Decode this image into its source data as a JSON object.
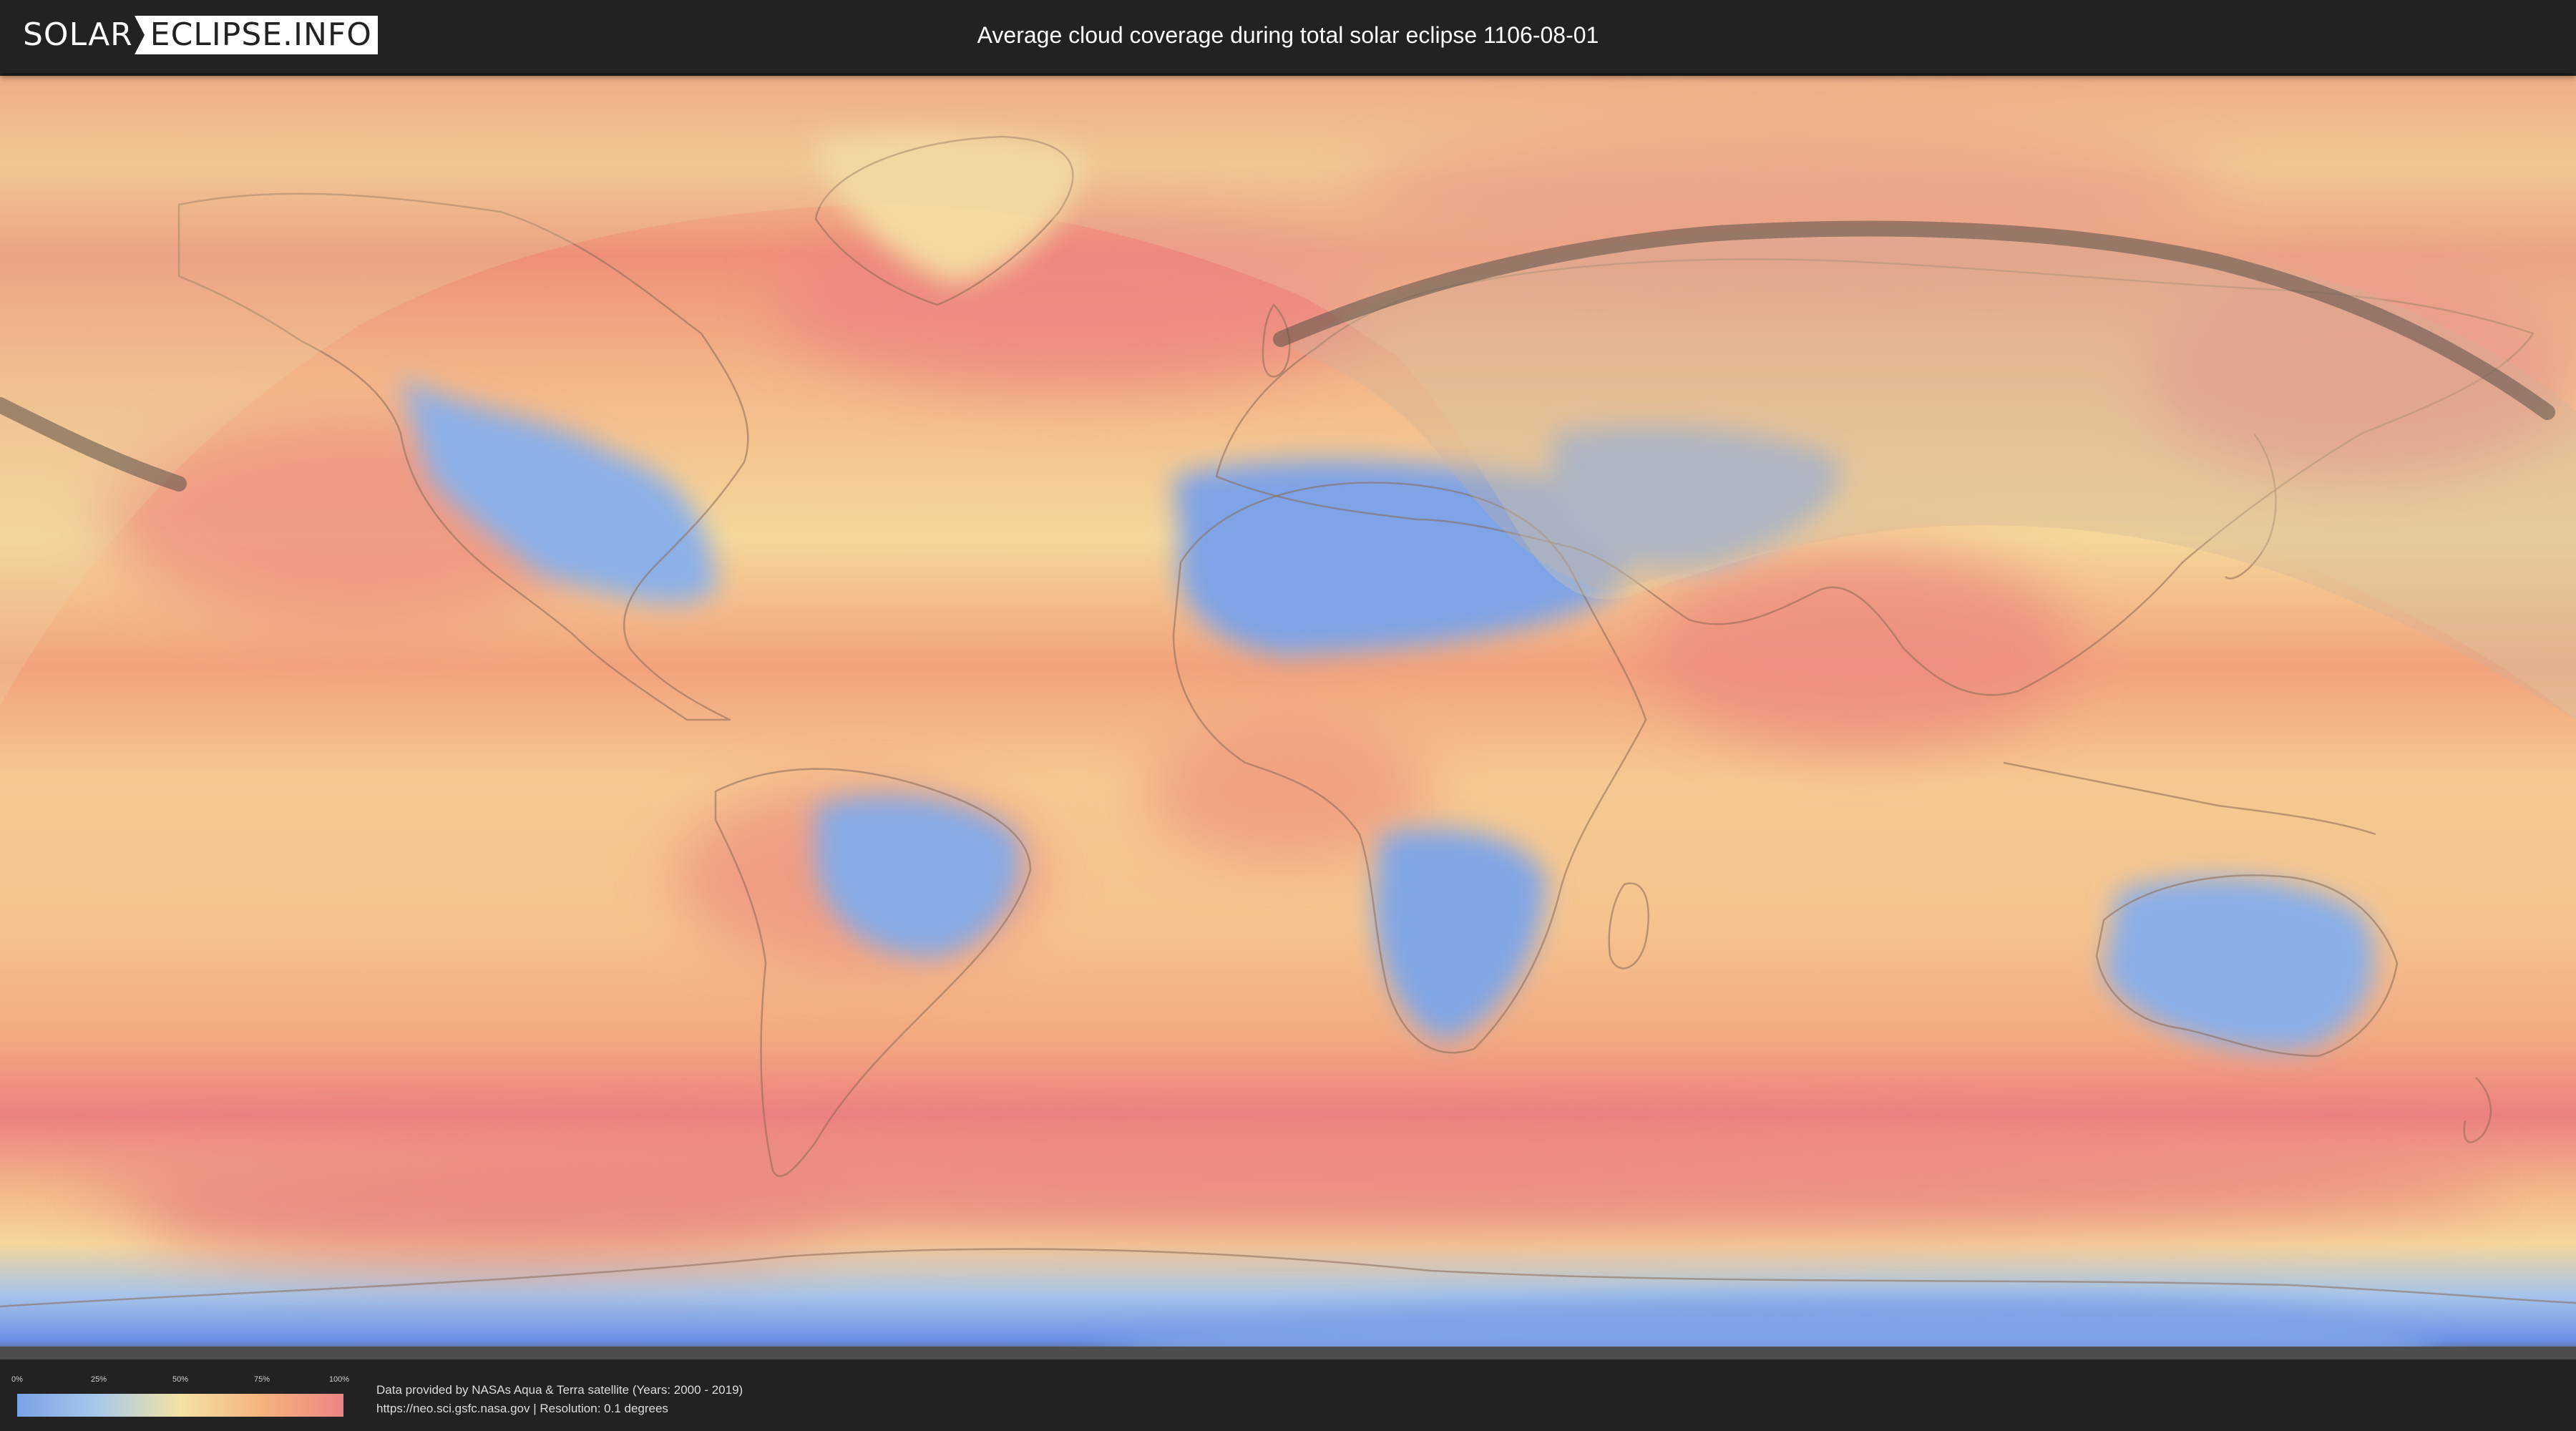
{
  "header": {
    "logo_part1": "SOLAR",
    "logo_part2": "ECLIPSE.INFO",
    "title": "Average cloud coverage during total solar eclipse 1106-08-01"
  },
  "map": {
    "description_layer": "cloud-coverage",
    "colors": {
      "clear_sky": "#7aa2e8",
      "light_clouds": "#a9c9ea",
      "medium_clouds": "#f3e2a4",
      "heavy_clouds": "#f5b37c",
      "overcast": "#ec8584",
      "eclipse_path": "#5a5048",
      "land_outline": "#8a6a55"
    }
  },
  "legend": {
    "ticks": [
      "0%",
      "25%",
      "50%",
      "75%",
      "100%"
    ],
    "tick_values": [
      0,
      25,
      50,
      75,
      100
    ]
  },
  "footer": {
    "credit_line1": "Data provided by NASAs Aqua & Terra satellite (Years: 2000 - 2019)",
    "credit_line2": "https://neo.sci.gsfc.nasa.gov | Resolution: 0.1 degrees"
  }
}
